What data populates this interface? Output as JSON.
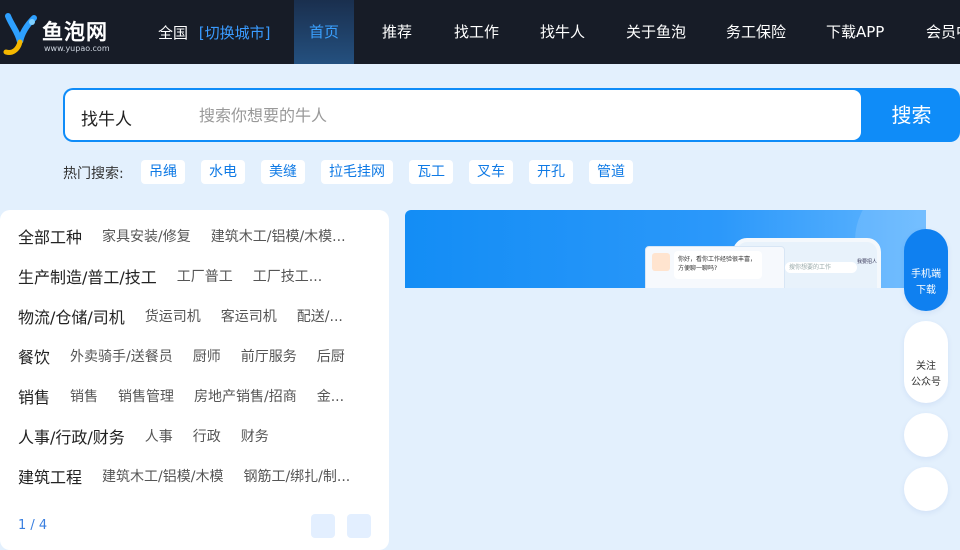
{
  "header": {
    "logo_text": "鱼泡网",
    "logo_url": "www.yupao.com",
    "city": "全国",
    "city_switch": "[切换城市]",
    "nav": [
      "首页",
      "推荐",
      "找工作",
      "找牛人",
      "关于鱼泡",
      "务工保险",
      "下载APP",
      "会员中心"
    ],
    "active_index": 0
  },
  "search": {
    "type_label": "找牛人",
    "placeholder": "搜索你想要的牛人",
    "value": "",
    "button_label": "搜索"
  },
  "hot": {
    "label": "热门搜索:",
    "tags": [
      "吊绳",
      "水电",
      "美缝",
      "拉毛挂网",
      "瓦工",
      "叉车",
      "开孔",
      "管道"
    ]
  },
  "categories": [
    {
      "main": "全部工种",
      "subs": [
        "家具安装/修复",
        "建筑木工/铝模/木模..."
      ]
    },
    {
      "main": "生产制造/普工/技工",
      "subs": [
        "工厂普工",
        "工厂技工..."
      ]
    },
    {
      "main": "物流/仓储/司机",
      "subs": [
        "货运司机",
        "客运司机",
        "配送/..."
      ]
    },
    {
      "main": "餐饮",
      "subs": [
        "外卖骑手/送餐员",
        "厨师",
        "前厅服务",
        "后厨"
      ]
    },
    {
      "main": "销售",
      "subs": [
        "销售",
        "销售管理",
        "房地产销售/招商",
        "金..."
      ]
    },
    {
      "main": "人事/行政/财务",
      "subs": [
        "人事",
        "行政",
        "财务"
      ]
    },
    {
      "main": "建筑工程",
      "subs": [
        "建筑木工/铝模/木模",
        "钢筋工/绑扎/制..."
      ]
    }
  ],
  "pager": {
    "text": "1 / 4"
  },
  "banner": {
    "chat_text": "你好，看你工作经验很丰富，方便聊一聊吗?",
    "phone_search": "搜你想要的工作",
    "phone_publish": "我要招人"
  },
  "side": {
    "app_label_1": "手机端",
    "app_label_2": "下载",
    "wechat_label_1": "关注",
    "wechat_label_2": "公众号"
  },
  "colors": {
    "header_bg": "#171c27",
    "accent": "#0f8cf8",
    "page_bg": "#e3f0fd"
  }
}
